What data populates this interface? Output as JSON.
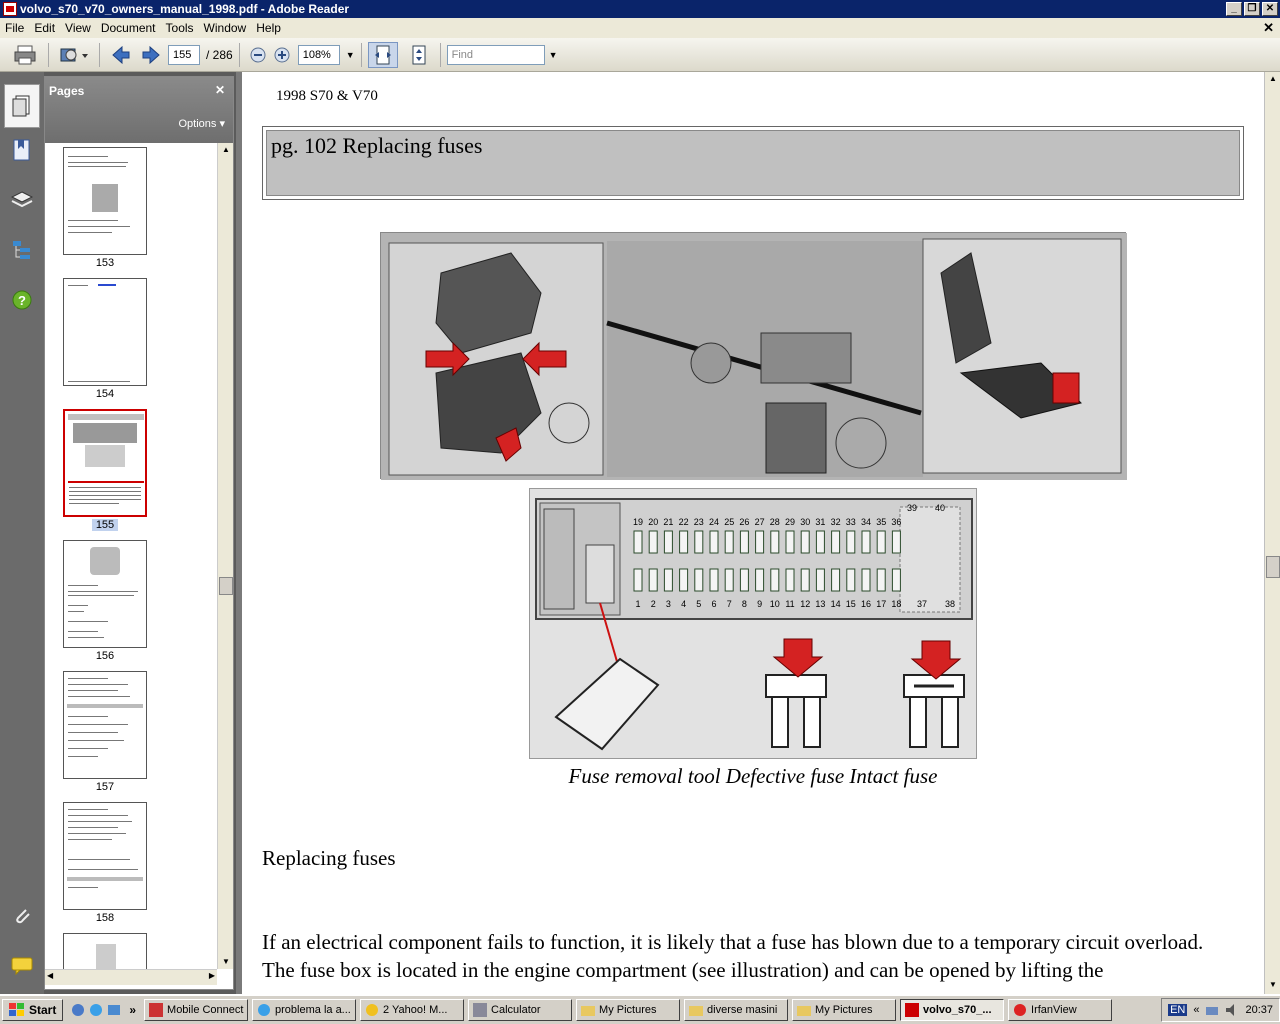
{
  "window": {
    "title": "volvo_s70_v70_owners_manual_1998.pdf - Adobe Reader"
  },
  "menu": [
    "File",
    "Edit",
    "View",
    "Document",
    "Tools",
    "Window",
    "Help"
  ],
  "toolbar": {
    "page_current": "155",
    "page_total": "/ 286",
    "zoom": "108%",
    "find_placeholder": "Find"
  },
  "pages_panel": {
    "title": "Pages",
    "options_label": "Options",
    "thumbnails": [
      "153",
      "154",
      "155",
      "156",
      "157",
      "158"
    ],
    "selected_page": "155"
  },
  "document": {
    "header": "1998 S70 & V70",
    "page_title": "pg. 102 Replacing fuses",
    "fuse_numbers_top": [
      "19",
      "20",
      "21",
      "22",
      "23",
      "24",
      "25",
      "26",
      "27",
      "28",
      "29",
      "30",
      "31",
      "32",
      "33",
      "34",
      "35",
      "36",
      "39",
      "40"
    ],
    "fuse_numbers_bottom": [
      "1",
      "2",
      "3",
      "4",
      "5",
      "6",
      "7",
      "8",
      "9",
      "10",
      "11",
      "12",
      "13",
      "14",
      "15",
      "16",
      "17",
      "18",
      "37",
      "38"
    ],
    "caption": "Fuse removal tool Defective fuse Intact fuse",
    "section_heading": "Replacing fuses",
    "paragraph": "If an electrical component fails to function, it is likely that a fuse has blown due to a temporary circuit overload.",
    "paragraph_cut": "The fuse box is located in the engine compartment (see illustration) and can be opened by lifting the"
  },
  "taskbar": {
    "start_label": "Start",
    "tasks": [
      "Mobile Connect",
      "problema la a...",
      "2 Yahoo! M...",
      "Calculator",
      "My Pictures",
      "diverse masini",
      "My Pictures",
      "volvo_s70_...",
      "IrfanView"
    ],
    "active_task": "volvo_s70_...",
    "language": "EN",
    "clock": "20:37"
  },
  "colors": {
    "title_bar": "#0a246a",
    "sidebar": "#5b5b5b",
    "selection": "#c00000"
  }
}
